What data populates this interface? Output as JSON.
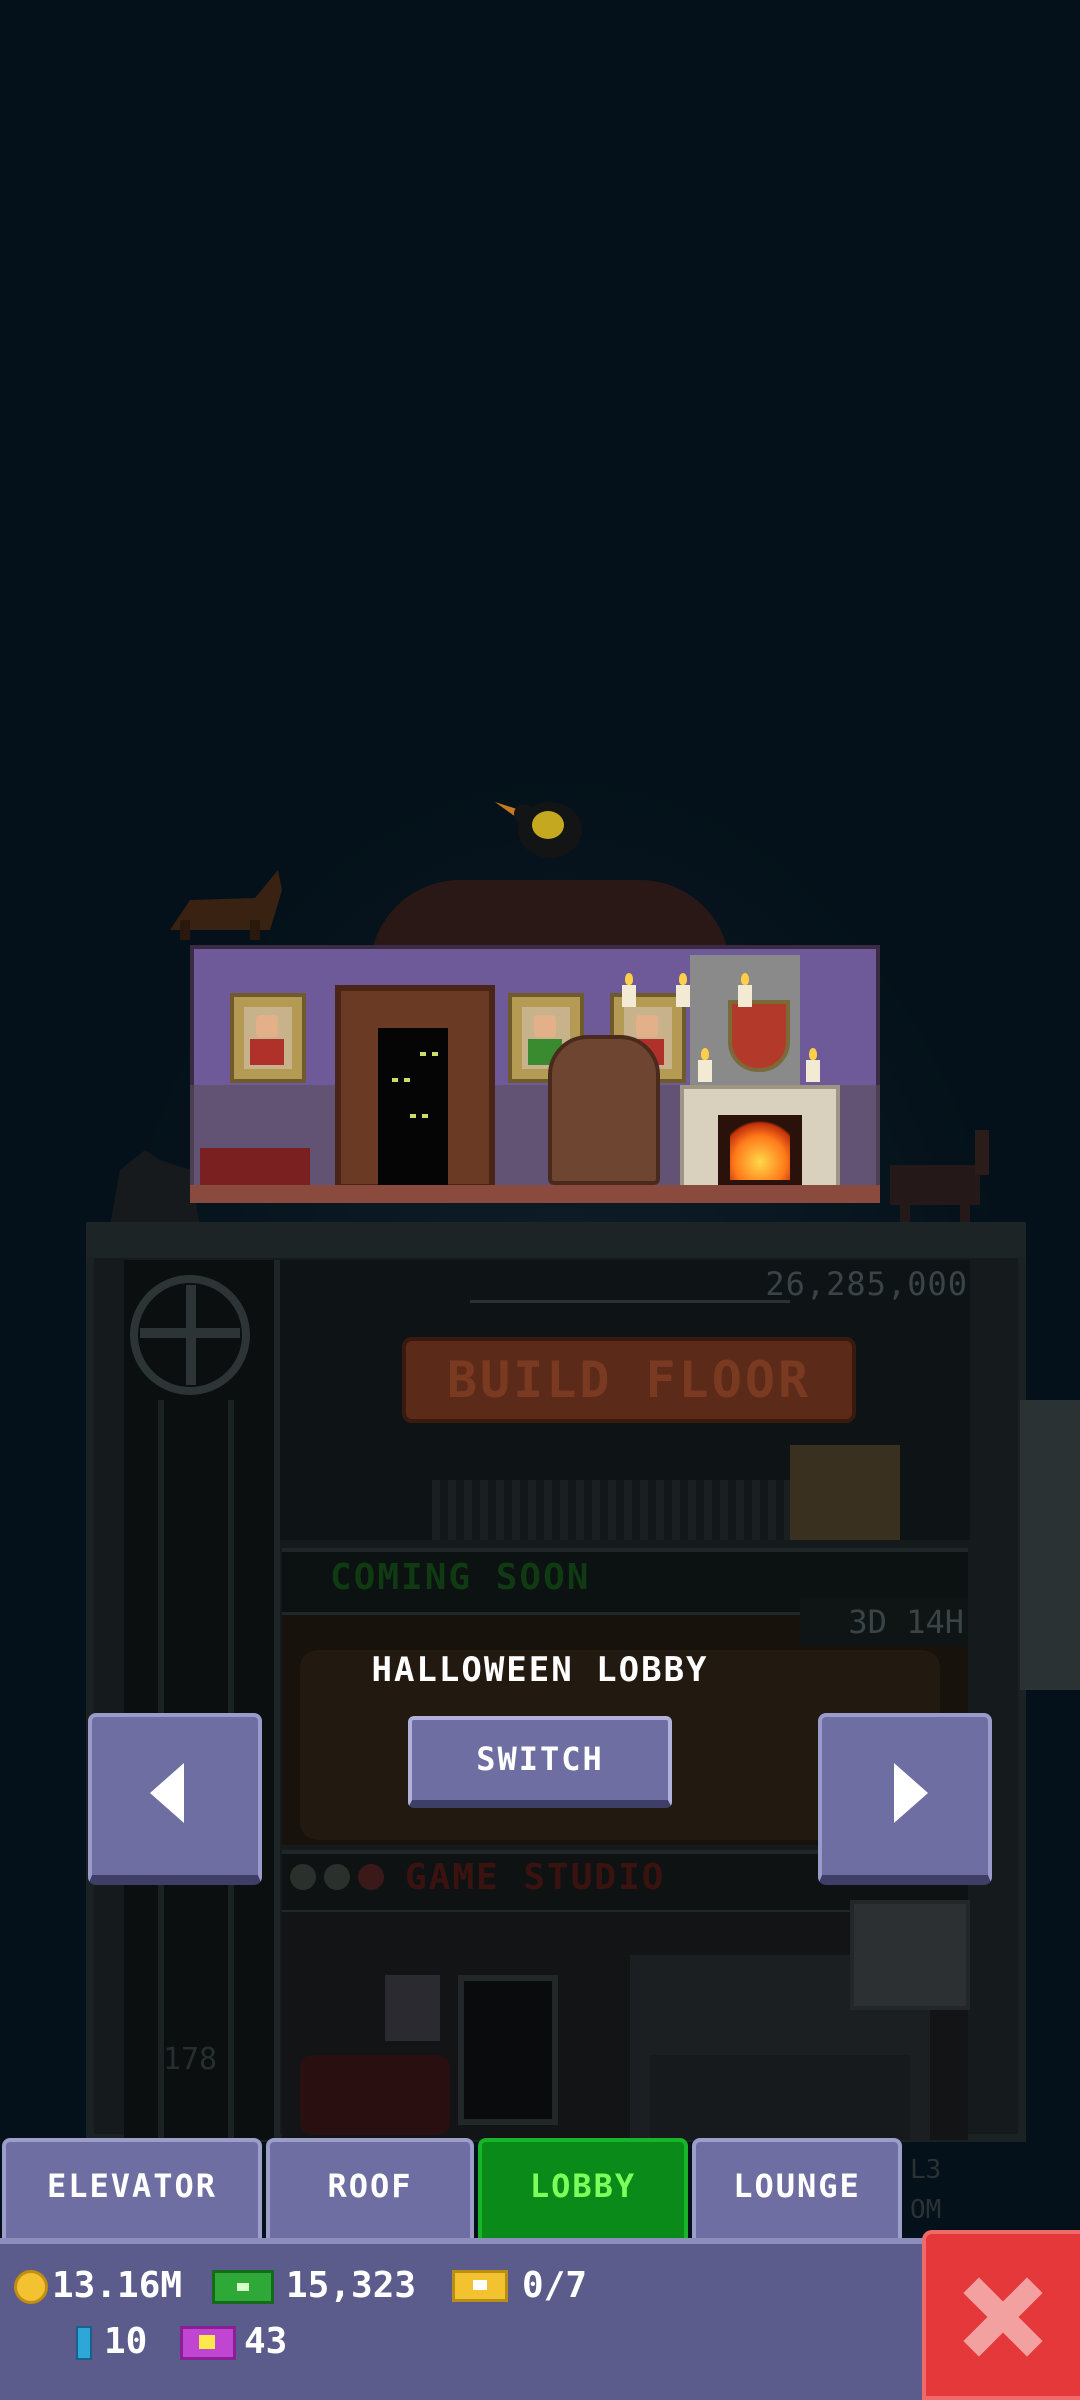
{
  "scene": {
    "floors": {
      "build_price": "26,285,000",
      "build_floor_label": "BUILD FLOOR",
      "coming_soon_label": "COMING SOON",
      "lobby_timer": "3D 14H",
      "game_studio_label": "GAME STUDIO",
      "floor_number": "178",
      "side_label_1": "L3",
      "side_label_2": "OM"
    }
  },
  "overlay": {
    "lobby_name": "HALLOWEEN LOBBY",
    "switch_label": "SWITCH",
    "prev_icon": "arrow-left",
    "next_icon": "arrow-right"
  },
  "tabs": [
    {
      "label": "ELEVATOR",
      "active": false
    },
    {
      "label": "ROOF",
      "active": false
    },
    {
      "label": "LOBBY",
      "active": true
    },
    {
      "label": "LOUNGE",
      "active": false
    }
  ],
  "status": {
    "coins": "13.16M",
    "cash": "15,323",
    "tickets": "0/7",
    "bux": "10",
    "vip": "43"
  },
  "colors": {
    "background": "#04111a",
    "button": "#6e6ea2",
    "active_tab": "#0a8a18",
    "close": "#e4383a"
  }
}
